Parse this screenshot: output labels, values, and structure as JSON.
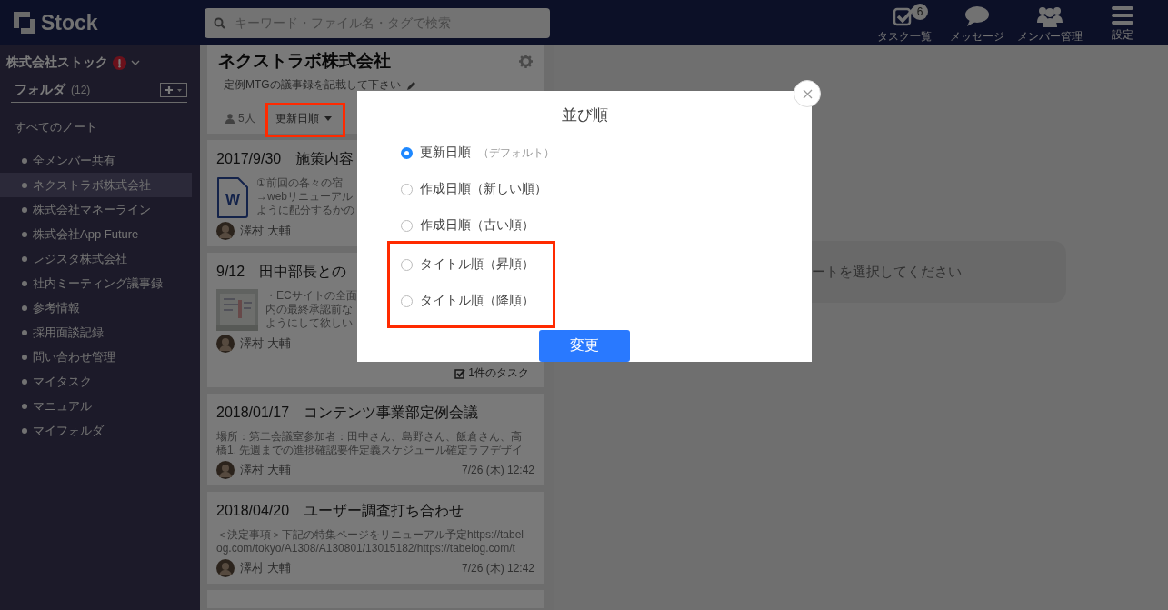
{
  "header": {
    "logo": "Stock",
    "search": {
      "placeholder": "キーワード・ファイル名・タグで検索"
    },
    "nav": [
      {
        "kind": "tasks",
        "label": "タスク一覧",
        "badge": "6"
      },
      {
        "kind": "messages",
        "label": "メッセージ"
      },
      {
        "kind": "members",
        "label": "メンバー管理"
      },
      {
        "kind": "settings",
        "label": "設定"
      }
    ]
  },
  "sidebar": {
    "team": "株式会社ストック",
    "alert": true,
    "folders_label": "フォルダ",
    "folders_count": "(12)",
    "all_notes": "すべてのノート",
    "items": [
      {
        "label": "全メンバー共有",
        "selected": false
      },
      {
        "label": "ネクストラボ株式会社",
        "selected": true
      },
      {
        "label": "株式会社マネーライン",
        "selected": false
      },
      {
        "label": "株式会社App Future",
        "selected": false
      },
      {
        "label": "レジスタ株式会社",
        "selected": false
      },
      {
        "label": "社内ミーティング議事録",
        "selected": false
      },
      {
        "label": "参考情報",
        "selected": false
      },
      {
        "label": "採用面談記録",
        "selected": false
      },
      {
        "label": "問い合わせ管理",
        "selected": false
      },
      {
        "label": "マイタスク",
        "selected": false
      },
      {
        "label": "マニュアル",
        "selected": false
      },
      {
        "label": "マイフォルダ",
        "selected": false
      }
    ]
  },
  "folder": {
    "title": "ネクストラボ株式会社",
    "description": "定例MTGの議事録を記載して下さい",
    "members": "5人",
    "sort_button": {
      "label": "更新日順",
      "highlighted": true
    }
  },
  "notes": [
    {
      "title": "2017/9/30　施策内容",
      "thumb": {
        "kind": "word",
        "label": "W"
      },
      "lines": [
        "①前回の各々の宿",
        "→webリニューアル",
        "ように配分するかの"
      ],
      "author": "澤村 大輔"
    },
    {
      "title": "9/12　田中部長との",
      "thumb": {
        "kind": "picture"
      },
      "lines": [
        "・ECサイトの全面",
        "内の最終承認前な",
        "ようにして欲しい"
      ],
      "author": "澤村 大輔",
      "tasks": "1件のタスク"
    },
    {
      "title": "2018/01/17　コンテンツ事業部定例会議",
      "lines": [
        "場所：第二会議室参加者：田中さん、島野さん、飯倉さん、高",
        "橋1. 先週までの進捗確認要件定義スケジュール確定ラフデザイ"
      ],
      "author": "澤村 大輔",
      "date": "7/26 (木) 12:42"
    },
    {
      "title": "2018/04/20　ユーザー調査打ち合わせ",
      "lines": [
        "＜決定事項＞下記の特集ページをリニューアル予定https://tabel",
        "og.com/tokyo/A1308/A130801/13015182/https://tabelog.com/t"
      ],
      "author": "澤村 大輔",
      "date": "7/26 (木) 12:42"
    }
  ],
  "detail": {
    "message": "ートを選択してください"
  },
  "sort_dialog": {
    "title": "並び順",
    "submit": "変更",
    "options": [
      {
        "label": "更新日順",
        "note": "（デフォルト）",
        "selected": true,
        "highlighted": false
      },
      {
        "label": "作成日順（新しい順）",
        "selected": false,
        "highlighted": false
      },
      {
        "label": "作成日順（古い順）",
        "selected": false,
        "highlighted": false
      },
      {
        "label": "タイトル順（昇順）",
        "selected": false,
        "highlighted": true
      },
      {
        "label": "タイトル順（降順）",
        "selected": false,
        "highlighted": true
      }
    ]
  }
}
